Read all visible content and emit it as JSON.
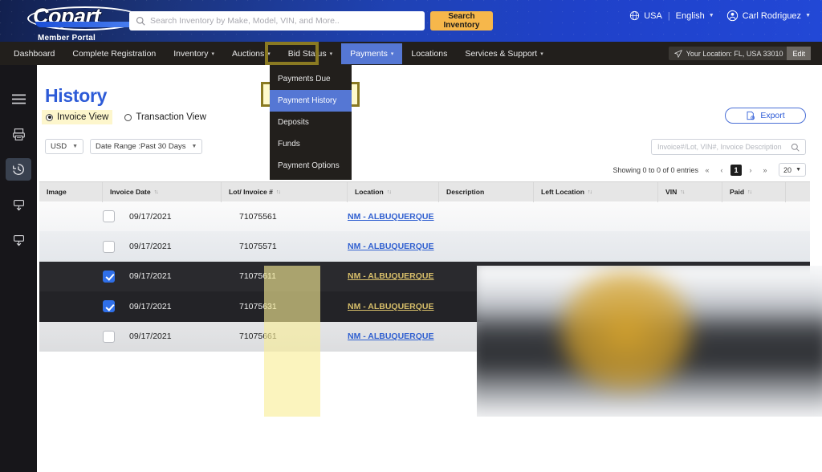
{
  "brand": {
    "name": "Copart",
    "subtitle": "Member Portal"
  },
  "search": {
    "placeholder": "Search Inventory by Make, Model, VIN, and More..",
    "value": "",
    "button_label": "Search Inventory",
    "icon": "search-icon"
  },
  "header_right": {
    "country": "USA",
    "country_icon": "globe-icon",
    "language": "English",
    "user": "Carl Rodriguez",
    "user_icon": "user-circle-icon",
    "separator": "|"
  },
  "nav": {
    "items": [
      {
        "label": "Dashboard",
        "caret": false,
        "active": false
      },
      {
        "label": "Complete Registration",
        "caret": false,
        "active": false
      },
      {
        "label": "Inventory",
        "caret": true,
        "active": false
      },
      {
        "label": "Auctions",
        "caret": true,
        "active": false
      },
      {
        "label": "Bid Status",
        "caret": true,
        "active": false
      },
      {
        "label": "Payments",
        "caret": true,
        "active": true
      },
      {
        "label": "Locations",
        "caret": false,
        "active": false
      },
      {
        "label": "Services & Support",
        "caret": true,
        "active": false
      }
    ],
    "location_chip": {
      "icon": "location-arrow-icon",
      "text": "Your Location: FL, USA 33010",
      "edit_label": "Edit"
    }
  },
  "dropdown": {
    "items": [
      {
        "label": "Payments Due",
        "selected": false
      },
      {
        "label": "Payment History",
        "selected": true
      },
      {
        "label": "Deposits",
        "selected": false
      },
      {
        "label": "Funds",
        "selected": false
      },
      {
        "label": "Payment Options",
        "selected": false
      }
    ]
  },
  "rail": {
    "items": [
      {
        "icon": "hamburger-menu-icon",
        "active": false
      },
      {
        "icon": "invoice-printer-icon",
        "active": false
      },
      {
        "icon": "history-clock-icon",
        "active": true
      },
      {
        "icon": "deposit-bank-icon",
        "active": false
      },
      {
        "icon": "funds-bank-icon",
        "active": false
      }
    ]
  },
  "page": {
    "title": "History",
    "views": [
      {
        "label": "Invoice View",
        "selected": true,
        "highlighted": true
      },
      {
        "label": "Transaction View",
        "selected": false,
        "highlighted": false
      }
    ],
    "filters": [
      {
        "name": "currency-select",
        "value": "USD"
      },
      {
        "name": "date-range-select",
        "value": "Date Range :Past 30 Days"
      }
    ],
    "export_label": "Export",
    "export_icon": "export-icon",
    "table_search_placeholder": "Invoice#/Lot, VIN#, Invoice Description",
    "table_search_value": "",
    "pagination": {
      "summary": "Showing 0 to 0 of 0 entries",
      "first": "«",
      "prev": "‹",
      "current": "1",
      "next": "›",
      "last": "»",
      "page_size": "20"
    }
  },
  "table": {
    "columns": [
      {
        "label": "Image",
        "sortable": false,
        "width": 79
      },
      {
        "label": "Invoice Date",
        "sortable": true,
        "width": 148
      },
      {
        "label": "Lot/ Invoice #",
        "sortable": true,
        "width": 157
      },
      {
        "label": "Location",
        "sortable": true,
        "width": 114
      },
      {
        "label": "Description",
        "sortable": false,
        "width": 118
      },
      {
        "label": "Left Location",
        "sortable": true,
        "width": 155
      },
      {
        "label": "VIN",
        "sortable": true,
        "width": 80
      },
      {
        "label": "Paid",
        "sortable": true,
        "width": 79
      },
      {
        "label": "",
        "sortable": false,
        "width": 30
      }
    ],
    "sort_icon": "sort-arrows-icon",
    "rows": [
      {
        "checked": false,
        "selected": false,
        "date": "09/17/2021",
        "lot": "71075561",
        "location": "NM - ALBUQUERQUE"
      },
      {
        "checked": false,
        "selected": false,
        "date": "09/17/2021",
        "lot": "71075571",
        "location": "NM - ALBUQUERQUE"
      },
      {
        "checked": true,
        "selected": true,
        "date": "09/17/2021",
        "lot": "71075611",
        "location": "NM - ALBUQUERQUE"
      },
      {
        "checked": true,
        "selected": true,
        "date": "09/17/2021",
        "lot": "71075631",
        "location": "NM - ALBUQUERQUE"
      },
      {
        "checked": false,
        "selected": false,
        "date": "09/17/2021",
        "lot": "71075661",
        "location": "NM - ALBUQUERQUE"
      }
    ]
  },
  "colors": {
    "header_blue": "#1f41c9",
    "nav_dark": "#221f1c",
    "accent_yellow": "#f6b74b",
    "link_blue": "#2d5bd7",
    "highlight_yellow": "#fdf6cc",
    "highlight_border": "#8a7a22",
    "active_nav": "#5577d4",
    "checkbox_blue": "#2f6fe8"
  }
}
